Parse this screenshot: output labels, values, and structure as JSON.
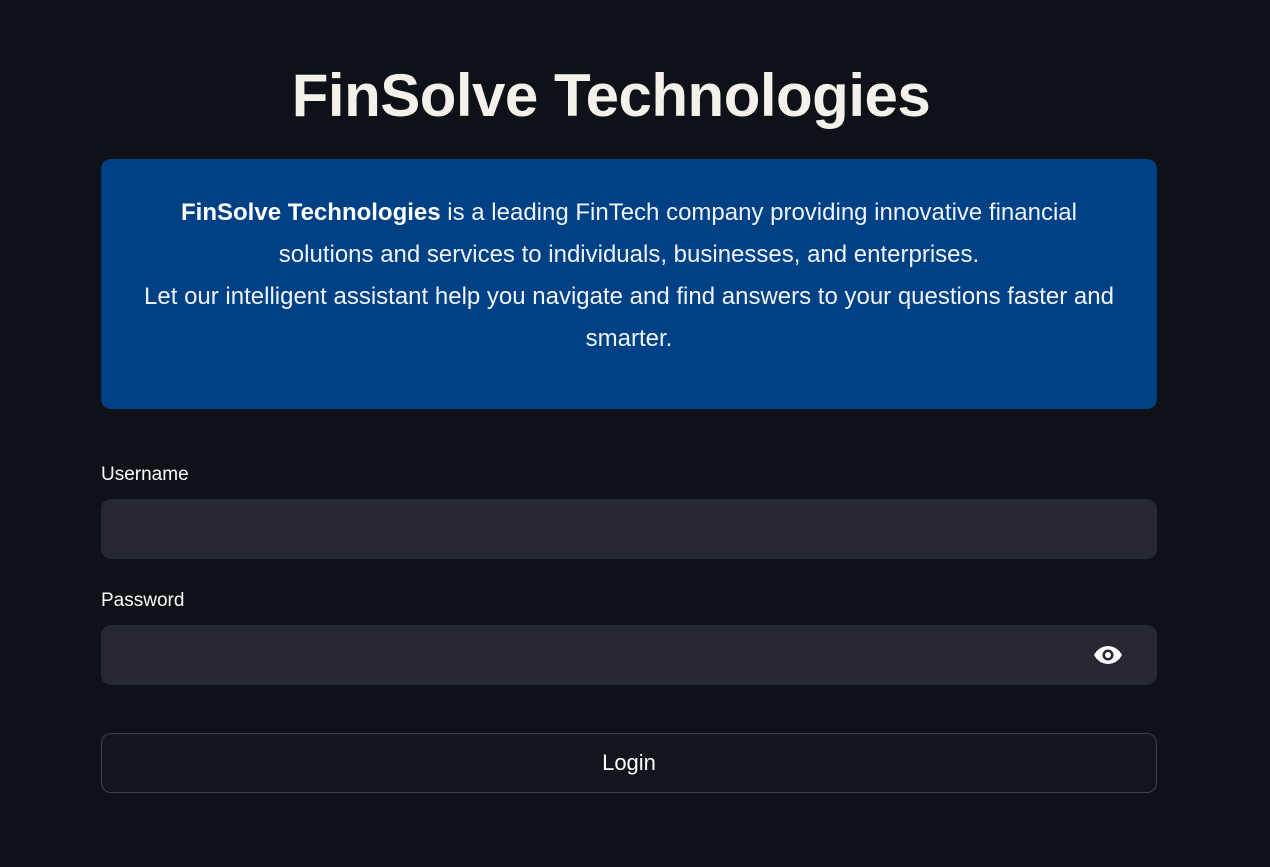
{
  "header": {
    "title": "FinSolve Technologies"
  },
  "info": {
    "company_name": "FinSolve Technologies",
    "line1_rest": " is a leading FinTech company providing innovative financial solutions and services to individuals, businesses, and enterprises.",
    "line2": "Let our intelligent assistant help you navigate and find answers to your questions faster and smarter."
  },
  "form": {
    "username_label": "Username",
    "username_value": "",
    "password_label": "Password",
    "password_value": "",
    "login_label": "Login"
  },
  "icons": {
    "show_password": "eye-icon"
  },
  "colors": {
    "background": "#0e1117",
    "info_box": "#004085",
    "input_bg": "#262730",
    "text": "#fafafa"
  }
}
